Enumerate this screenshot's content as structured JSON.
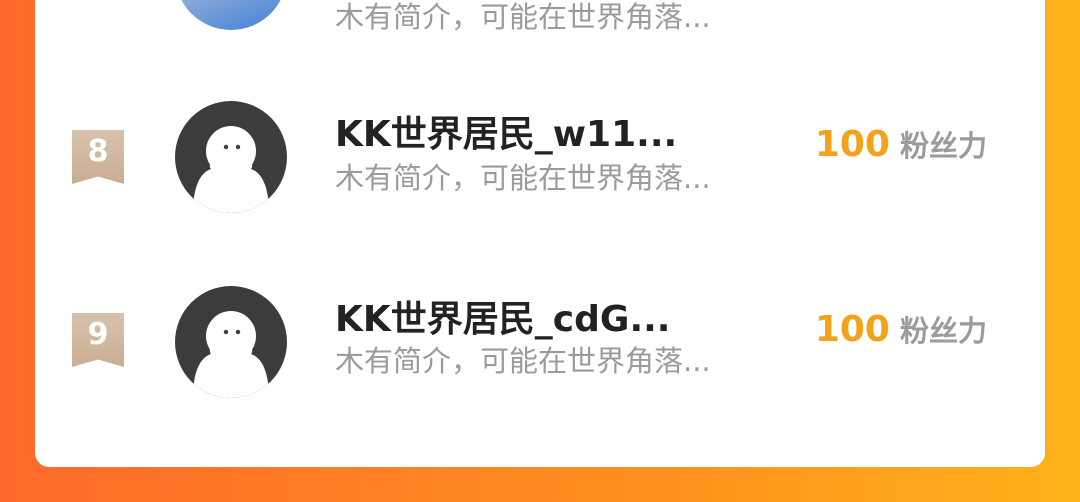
{
  "previous_row": {
    "bio": "木有简介，可能在世界角落..."
  },
  "rows": [
    {
      "rank": "8",
      "name": "KK世界居民_w11...",
      "bio": "木有简介，可能在世界角落...",
      "fans_count": "100",
      "fans_label": "粉丝力"
    },
    {
      "rank": "9",
      "name": "KK世界居民_cdG...",
      "bio": "木有简介，可能在世界角落...",
      "fans_count": "100",
      "fans_label": "粉丝力"
    }
  ],
  "colors": {
    "background_start": "#ff6a2b",
    "background_end": "#ffb21a",
    "fans_count": "#f2a31b",
    "rank_badge": "#c9ad92",
    "name": "#222222",
    "bio": "#9b9b9b"
  },
  "icons": {
    "rank_badge": "bookmark-ribbon-icon",
    "default_avatar": "default-avatar-figure-icon"
  }
}
